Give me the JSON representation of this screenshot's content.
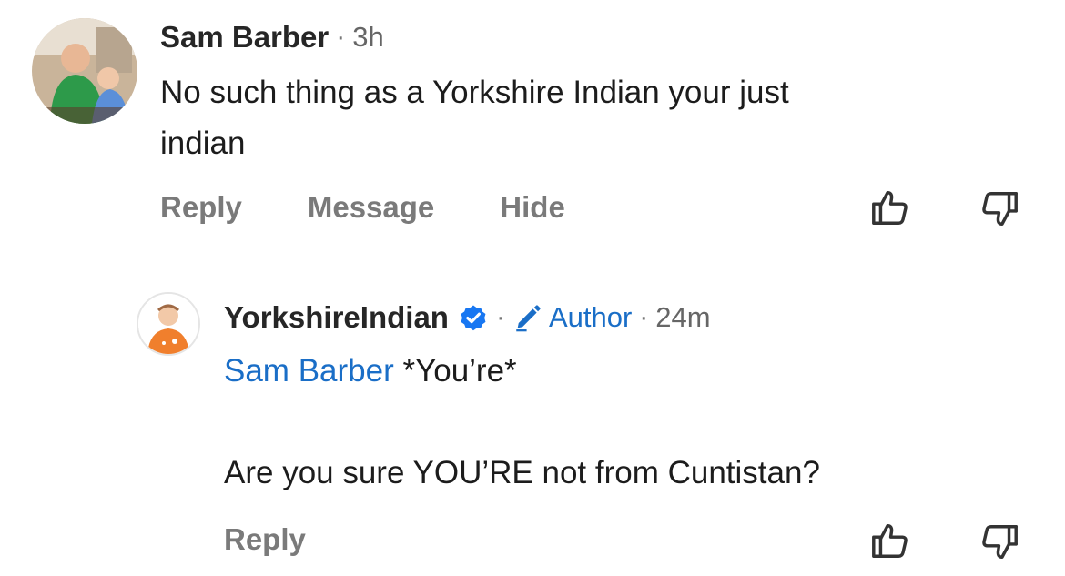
{
  "comment": {
    "author": "Sam Barber",
    "separator": "·",
    "time": "3h",
    "text_line1": "No such thing as a Yorkshire Indian your just",
    "text_line2": "indian",
    "actions": {
      "reply": "Reply",
      "message": "Message",
      "hide": "Hide"
    }
  },
  "reply": {
    "author": "YorkshireIndian",
    "separator1": "·",
    "author_badge": "Author",
    "separator2": "·",
    "time": "24m",
    "mention": "Sam Barber",
    "text_line1_rest": " *You’re*",
    "text_line2": "Are you sure YOU’RE not from Cuntistan?",
    "actions": {
      "reply": "Reply"
    }
  },
  "icons": {
    "like": "thumbs-up-icon",
    "dislike": "thumbs-down-icon",
    "verified": "verified-check-icon",
    "author": "pencil-icon"
  },
  "colors": {
    "link_blue": "#1a6ec7",
    "action_gray": "#7a7a7a"
  }
}
